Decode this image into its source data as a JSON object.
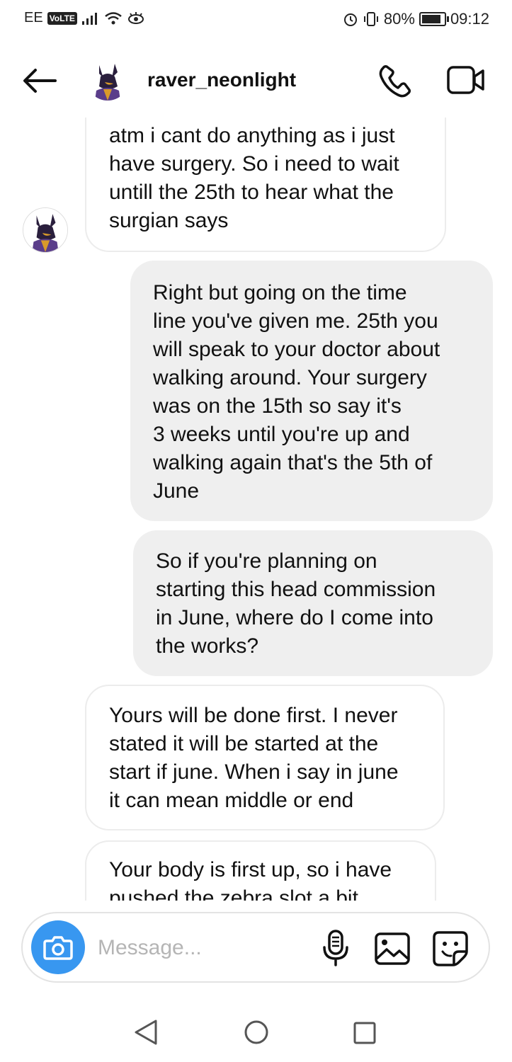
{
  "status_bar": {
    "carrier": "EE",
    "volte": "VoLTE",
    "battery": "80%",
    "time": "09:12"
  },
  "header": {
    "username": "raver_neonlight"
  },
  "messages": [
    {
      "side": "incoming",
      "text": "atm i cant do anything as i just\nhave surgery. So i need to wait\nuntill the 25th to hear what the\nsurgian says"
    },
    {
      "side": "outgoing",
      "text": "Right but going on the time\nline you've given me. 25th you\nwill speak to your doctor about\nwalking around. Your surgery\nwas on the 15th so say it's\n3 weeks until you're up and\nwalking again that's the 5th of\nJune"
    },
    {
      "side": "outgoing",
      "text": "So if you're planning on\nstarting this head commission\nin June, where do I come into\nthe works?"
    },
    {
      "side": "incoming",
      "text": "Yours will be done first. I never\nstated it will be started at the\nstart if june. When i say in june\nit can mean middle or end"
    },
    {
      "side": "incoming",
      "text": "Your body is first up, so i have\npushed the zebra slot a bit"
    }
  ],
  "composer": {
    "placeholder": "Message..."
  },
  "colors": {
    "accent": "#3897f0",
    "outgoing_bubble": "#efefef",
    "incoming_border": "#ececec"
  }
}
